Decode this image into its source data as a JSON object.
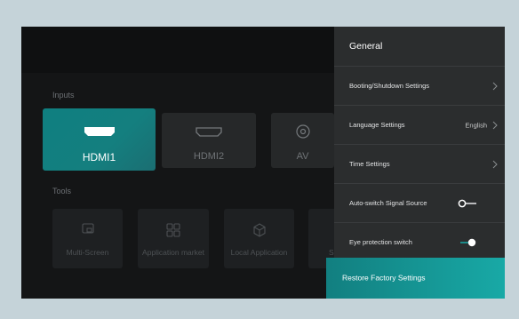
{
  "inputs": {
    "section_label": "Inputs",
    "tiles": [
      {
        "label": "HDMI1",
        "icon": "hdmi-port-icon",
        "selected": true
      },
      {
        "label": "HDMI2",
        "icon": "hdmi-port-icon",
        "selected": false
      },
      {
        "label": "AV",
        "icon": "av-jack-icon",
        "selected": false
      }
    ]
  },
  "tools": {
    "section_label": "Tools",
    "items": [
      {
        "label": "Multi-Screen",
        "icon": "multi-screen-icon"
      },
      {
        "label": "Application market",
        "icon": "app-grid-icon"
      },
      {
        "label": "Local Application",
        "icon": "cube-icon"
      },
      {
        "label": "S",
        "icon": "tool-icon"
      }
    ]
  },
  "settings": {
    "title": "General",
    "rows": [
      {
        "label": "Booting/Shutdown Settings",
        "value": "",
        "control": "chevron"
      },
      {
        "label": "Language Settings",
        "value": "English",
        "control": "chevron"
      },
      {
        "label": "Time Settings",
        "value": "",
        "control": "chevron"
      },
      {
        "label": "Auto-switch Signal Source",
        "value": "",
        "control": "toggle",
        "on": false
      },
      {
        "label": "Eye protection switch",
        "value": "",
        "control": "toggle",
        "on": true
      }
    ],
    "restore_label": "Restore Factory Settings"
  },
  "colors": {
    "accent": "#13807f",
    "panel": "#2b2d2e",
    "screen": "#141516",
    "bezel": "#c5d3d9"
  }
}
